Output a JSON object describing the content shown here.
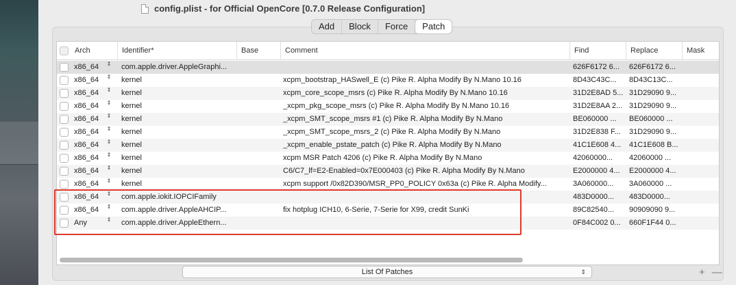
{
  "window": {
    "title": "config.plist - for Official OpenCore [0.7.0 Release Configuration]"
  },
  "tabs": [
    {
      "label": "Add",
      "active": false
    },
    {
      "label": "Block",
      "active": false
    },
    {
      "label": "Force",
      "active": false
    },
    {
      "label": "Patch",
      "active": true
    }
  ],
  "columns": {
    "arch": "Arch",
    "identifier": "Identifier*",
    "base": "Base",
    "comment": "Comment",
    "find": "Find",
    "replace": "Replace",
    "mask": "Mask"
  },
  "rows": [
    {
      "arch": "x86_64",
      "identifier": "com.apple.driver.AppleGraphi...",
      "base": "",
      "comment": "",
      "find": "626F6172 6...",
      "replace": "626F6172 6..."
    },
    {
      "arch": "x86_64",
      "identifier": "kernel",
      "base": "",
      "comment": "xcpm_bootstrap_HASwell_E (c) Pike R. Alpha Modify By N.Mano 10.16",
      "find": "8D43C43C...",
      "replace": "8D43C13C..."
    },
    {
      "arch": "x86_64",
      "identifier": "kernel",
      "base": "",
      "comment": "xcpm_core_scope_msrs (c) Pike R. Alpha Modify By N.Mano 10.16",
      "find": "31D2E8AD 5...",
      "replace": "31D29090 9..."
    },
    {
      "arch": "x86_64",
      "identifier": "kernel",
      "base": "",
      "comment": "_xcpm_pkg_scope_msrs (c) Pike R. Alpha Modify By N.Mano 10.16",
      "find": "31D2E8AA 2...",
      "replace": "31D29090 9..."
    },
    {
      "arch": "x86_64",
      "identifier": "kernel",
      "base": "",
      "comment": "_xcpm_SMT_scope_msrs #1 (c) Pike R. Alpha Modify By N.Mano",
      "find": "BE060000 ...",
      "replace": "BE060000 ..."
    },
    {
      "arch": "x86_64",
      "identifier": "kernel",
      "base": "",
      "comment": "_xcpm_SMT_scope_msrs_2 (c) Pike R. Alpha Modify By N.Mano",
      "find": "31D2E838 F...",
      "replace": "31D29090 9..."
    },
    {
      "arch": "x86_64",
      "identifier": "kernel",
      "base": "",
      "comment": "_xcpm_enable_pstate_patch (c) Pike R. Alpha Modify By N.Mano",
      "find": "41C1E608 4...",
      "replace": "41C1E608 B..."
    },
    {
      "arch": "x86_64",
      "identifier": "kernel",
      "base": "",
      "comment": "xcpm MSR Patch 4206 (c) Pike R. Alpha Modify By N.Mano",
      "find": "42060000...",
      "replace": "42060000 ..."
    },
    {
      "arch": "x86_64",
      "identifier": "kernel",
      "base": "",
      "comment": "C6/C7_lf=E2-Enabled=0x7E000403  (c) Pike R. Alpha Modify By N.Mano",
      "find": "E2000000 4...",
      "replace": "E2000000 4..."
    },
    {
      "arch": "x86_64",
      "identifier": "kernel",
      "base": "",
      "comment": "xcpm support /0x82D390/MSR_PP0_POLICY 0x63a (c) Pike R. Alpha Modify...",
      "find": "3A060000...",
      "replace": "3A060000 ..."
    },
    {
      "arch": "x86_64",
      "identifier": "com.apple.iokit.IOPCIFamily",
      "base": "",
      "comment": "",
      "find": "483D0000...",
      "replace": "483D0000..."
    },
    {
      "arch": "x86_64",
      "identifier": "com.apple.driver.AppleAHCIP...",
      "base": "",
      "comment": "fix hotplug ICH10, 6-Serie, 7-Serie for X99, credit SunKi",
      "find": "89C82540...",
      "replace": "90909090 9..."
    },
    {
      "arch": "Any",
      "identifier": "com.apple.driver.AppleEthern...",
      "base": "",
      "comment": "",
      "find": "0F84C002 0...",
      "replace": "660F1F44 0..."
    }
  ],
  "bottom_select": {
    "value": "List Of Patches"
  },
  "icons": {
    "stepper": "⇕",
    "add_remove": "+ —"
  },
  "colors": {
    "highlight": "#e0382a",
    "selected_row": "#e0e0e0"
  }
}
